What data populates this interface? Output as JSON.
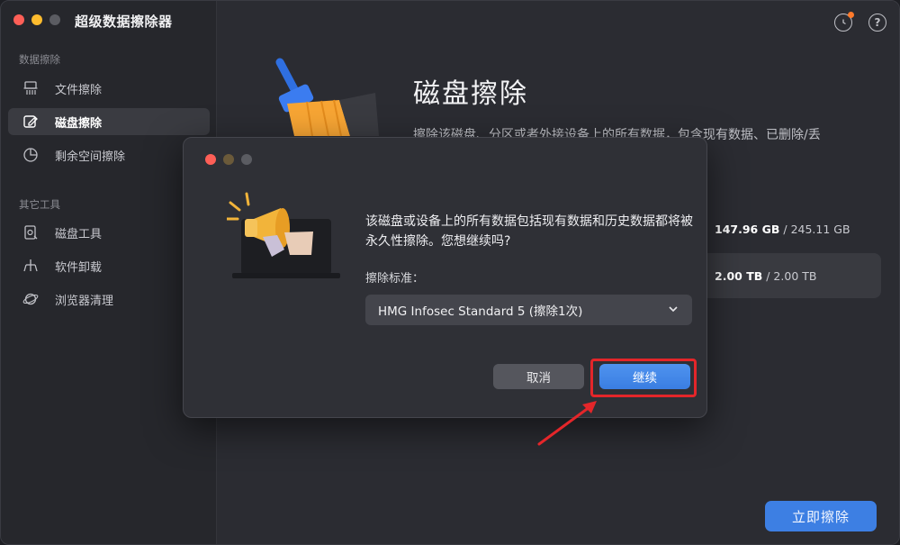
{
  "app": {
    "title": "超级数据擦除器"
  },
  "sidebar": {
    "section1_label": "数据擦除",
    "section2_label": "其它工具",
    "items": [
      {
        "label": "文件擦除",
        "icon": "file-shred-icon",
        "active": false
      },
      {
        "label": "磁盘擦除",
        "icon": "disk-edit-icon",
        "active": true
      },
      {
        "label": "剩余空间擦除",
        "icon": "pie-chart-icon",
        "active": false
      },
      {
        "label": "磁盘工具",
        "icon": "disk-tool-icon",
        "active": false
      },
      {
        "label": "软件卸载",
        "icon": "uninstall-icon",
        "active": false
      },
      {
        "label": "浏览器清理",
        "icon": "planet-icon",
        "active": false
      }
    ]
  },
  "main": {
    "title": "磁盘擦除",
    "description": "擦除该磁盘、分区或者外接设备上的所有数据，包含现有数据、已删除/丢",
    "disks": [
      {
        "used": "147.96 GB",
        "total": "/ 245.11 GB"
      },
      {
        "used": "2.00 TB",
        "total": "/ 2.00 TB"
      }
    ],
    "wipe_now_label": "立即擦除"
  },
  "dialog": {
    "message": "该磁盘或设备上的所有数据包括现有数据和历史数据都将被永久性擦除。您想继续吗?",
    "standard_label": "擦除标准：",
    "standard_value": "HMG Infosec Standard 5 (擦除1次)",
    "cancel_label": "取消",
    "continue_label": "继续"
  },
  "colors": {
    "accent": "#3d7fe3",
    "annotation": "#e4262a",
    "close": "#fe5f57",
    "minimize": "#febc2e",
    "zoom": "#28c840"
  }
}
